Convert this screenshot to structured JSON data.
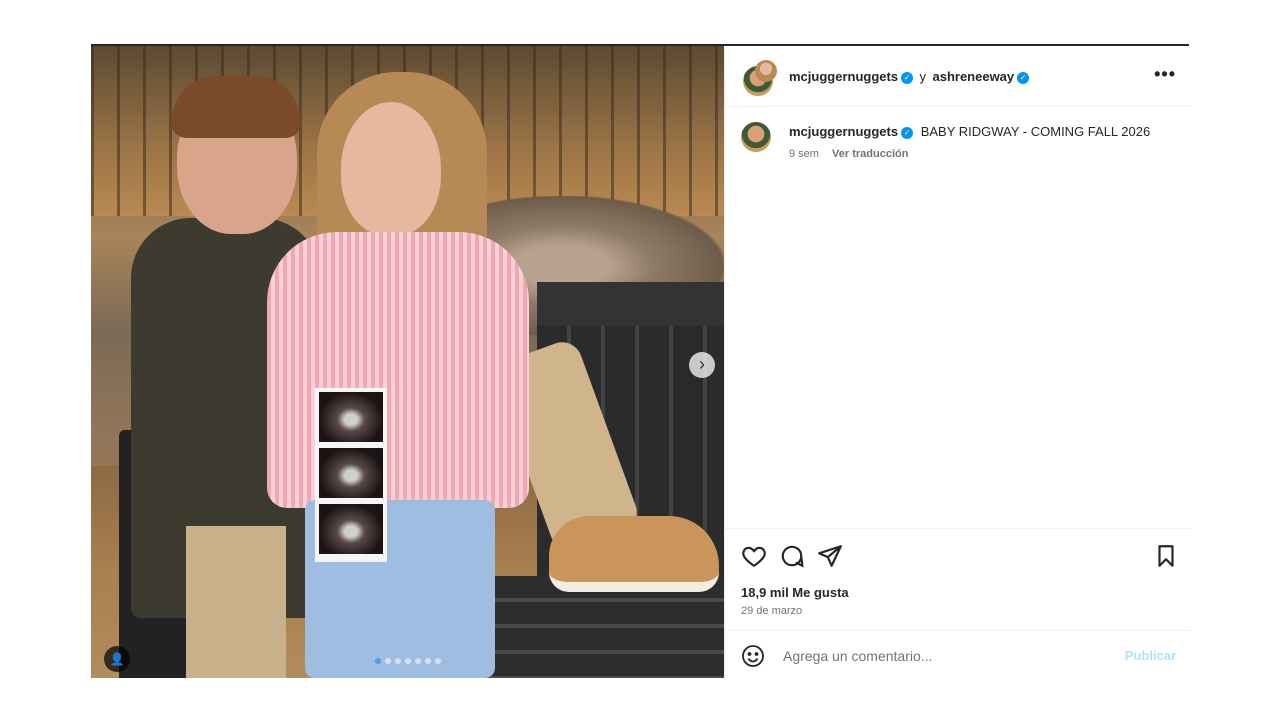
{
  "post": {
    "header": {
      "author": "mcjuggernuggets",
      "conjunction": "y",
      "collaborator": "ashreneeway",
      "more_icon": "more-horizontal-icon",
      "more_label": "•••"
    },
    "caption": {
      "author": "mcjuggernuggets",
      "text": "BABY RIDGWAY - COMING FALL 2026",
      "age": "9 sem",
      "translate": "Ver traducción"
    },
    "media": {
      "next_icon": "chevron-right-icon",
      "next_label": "›",
      "tag_icon": "user-tag-icon",
      "tag_label": "👤"
    },
    "actions": {
      "like_icon": "heart-icon",
      "comment_icon": "comment-icon",
      "share_icon": "send-icon",
      "save_icon": "bookmark-icon"
    },
    "likes": "18,9 mil Me gusta",
    "date": "29 de marzo",
    "comment_box": {
      "emoji_icon": "emoji-icon",
      "placeholder": "Agrega un comentario...",
      "publish_label": "Publicar"
    },
    "colors": {
      "verified": "#0095f6",
      "publish": "#b2dffc",
      "carousel_active_dot": "#4a9cf0"
    }
  }
}
